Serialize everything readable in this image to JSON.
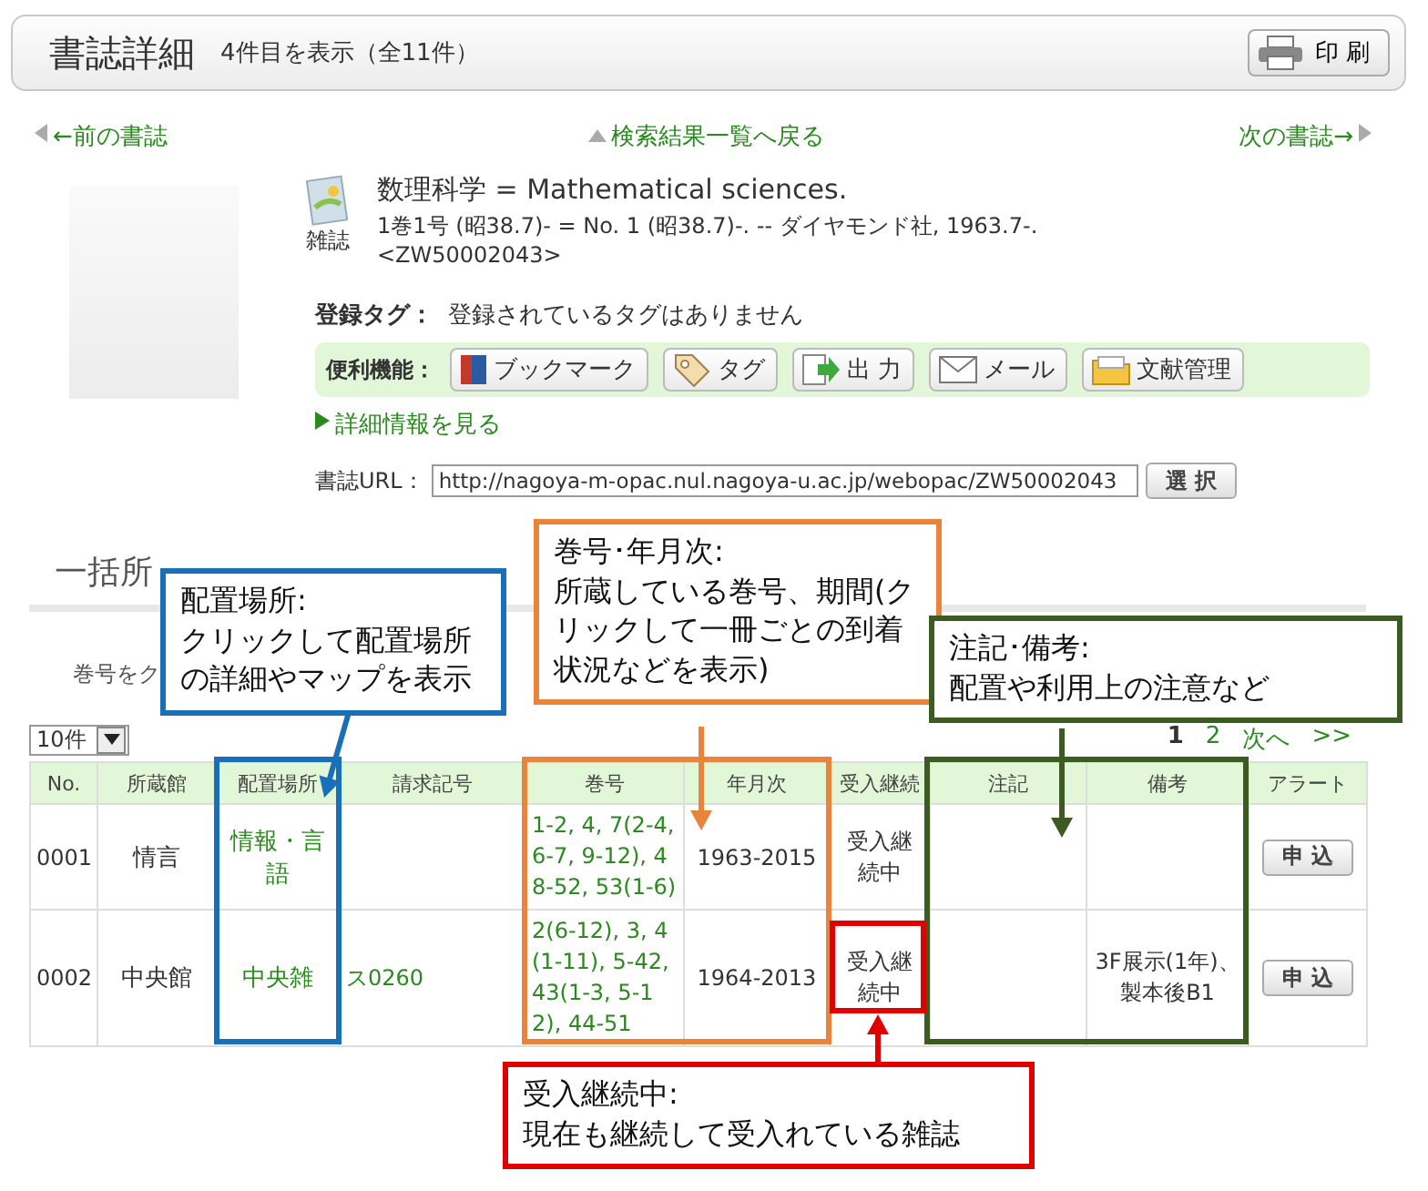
{
  "header": {
    "title": "書誌詳細",
    "count": "4件目を表示（全11件）",
    "print_button": "印 刷"
  },
  "nav": {
    "prev": "←前の書誌",
    "back": "検索結果一覧へ戻る",
    "next": "次の書誌→"
  },
  "record": {
    "material_type": "雑誌",
    "title": "数理科学 = Mathematical sciences.",
    "description": "1巻1号 (昭38.7)- = No. 1 (昭38.7)-. -- ダイヤモンド社, 1963.7-.",
    "id": "<ZW50002043>",
    "tags_label": "登録タグ：",
    "tags_value": "登録されているタグはありません",
    "tools_label": "便利機能：",
    "tools": [
      {
        "kind": "bookmark",
        "label": "ブックマーク"
      },
      {
        "kind": "tag",
        "label": "タグ"
      },
      {
        "kind": "export",
        "label": "出 力"
      },
      {
        "kind": "mail",
        "label": "メール"
      },
      {
        "kind": "folder",
        "label": "文献管理"
      }
    ],
    "detail_link": "詳細情報を見る",
    "url_label": "書誌URL：",
    "url": "http://nagoya-m-opac.nul.nagoya-u.ac.jp/webopac/ZW50002043",
    "select_button": "選 択"
  },
  "holdings": {
    "heading": "一括所",
    "note": "巻号をク",
    "per_page": "10件",
    "pages": [
      {
        "label": "1",
        "selected": true
      },
      {
        "label": "2",
        "selected": false
      }
    ],
    "next": "次へ",
    "last": ">>",
    "columns": [
      "No.",
      "所蔵館",
      "配置場所",
      "請求記号",
      "巻号",
      "年月次",
      "受入継続",
      "注記",
      "備考",
      "アラート"
    ],
    "rows": [
      {
        "no": "0001",
        "library": "情言",
        "location": "情報・言語",
        "volumes": "1-2, 4, 7(2-4, 6-7, 9-12), 48-52, 53(1-6)",
        "years": "1963-2015",
        "receiving": "受入継続中",
        "alert_button": "申 込"
      },
      {
        "no": "0002",
        "library": "中央館",
        "location": "中央雑",
        "call_number": "ス0260",
        "volumes": "2(6-12), 3, 4(1-11), 5-42, 43(1-3, 5-12), 44-51",
        "years": "1964-2013",
        "receiving": "受入継続中",
        "remarks": "3F展示(1年)、製本後B1",
        "alert_button": "申 込"
      }
    ]
  },
  "annotations": [
    {
      "kind": "location",
      "color": "#1a70b8",
      "title": "配置場所:",
      "text": "クリックして配置場所の詳細やマップを表示"
    },
    {
      "kind": "volumes",
      "color": "#e8843c",
      "title": "巻号･年月次:",
      "text": "所蔵している巻号、期間(クリックして一冊ごとの到着状況などを表示)"
    },
    {
      "kind": "notes",
      "color": "#3b5b23",
      "title": "注記･備考:",
      "text": "配置や利用上の注意など"
    },
    {
      "kind": "receiving",
      "color": "#e00000",
      "title": "受入継続中:",
      "text": "現在も継続して受入れている雑誌"
    }
  ]
}
